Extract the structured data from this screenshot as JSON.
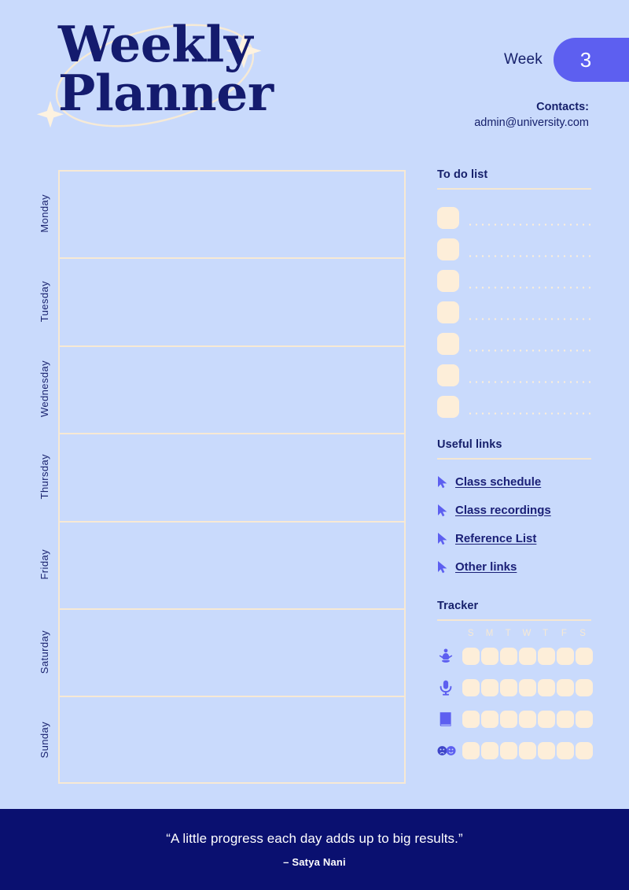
{
  "colors": {
    "background": "#c9dafc",
    "navy": "#16206b",
    "deep_navy": "#0a1070",
    "purple": "#5d5ff0",
    "cream": "#fdeed9",
    "white": "#ffffff"
  },
  "header": {
    "title_line1": "Weekly",
    "title_line2": "Planner",
    "week_label": "Week",
    "week_number": "3",
    "contacts_label": "Contacts:",
    "contacts_email": "admin@university.com"
  },
  "days": [
    {
      "label": "Monday"
    },
    {
      "label": "Tuesday"
    },
    {
      "label": "Wednesday"
    },
    {
      "label": "Thursday"
    },
    {
      "label": "Friday"
    },
    {
      "label": "Saturday"
    },
    {
      "label": "Sunday"
    }
  ],
  "todo": {
    "heading": "To do list",
    "items": [
      {
        "checked": false,
        "text": ""
      },
      {
        "checked": false,
        "text": ""
      },
      {
        "checked": false,
        "text": ""
      },
      {
        "checked": false,
        "text": ""
      },
      {
        "checked": false,
        "text": ""
      },
      {
        "checked": false,
        "text": ""
      },
      {
        "checked": false,
        "text": ""
      }
    ]
  },
  "links": {
    "heading": "Useful links",
    "items": [
      {
        "label": "Class schedule",
        "icon": "cursor-arrow-icon"
      },
      {
        "label": "Class recordings",
        "icon": "cursor-arrow-icon"
      },
      {
        "label": "Reference List",
        "icon": "cursor-arrow-icon"
      },
      {
        "label": "Other links",
        "icon": "cursor-arrow-icon"
      }
    ]
  },
  "tracker": {
    "heading": "Tracker",
    "day_initials": [
      "S",
      "M",
      "T",
      "W",
      "T",
      "F",
      "S"
    ],
    "rows": [
      {
        "icon": "meditation-icon",
        "cells": [
          false,
          false,
          false,
          false,
          false,
          false,
          false
        ]
      },
      {
        "icon": "microphone-icon",
        "cells": [
          false,
          false,
          false,
          false,
          false,
          false,
          false
        ]
      },
      {
        "icon": "book-icon",
        "cells": [
          false,
          false,
          false,
          false,
          false,
          false,
          false
        ]
      },
      {
        "icon": "mood-faces-icon",
        "cells": [
          false,
          false,
          false,
          false,
          false,
          false,
          false
        ]
      }
    ]
  },
  "footer": {
    "quote": "“A little progress each day adds up to big results.”",
    "author": "– Satya Nani"
  }
}
